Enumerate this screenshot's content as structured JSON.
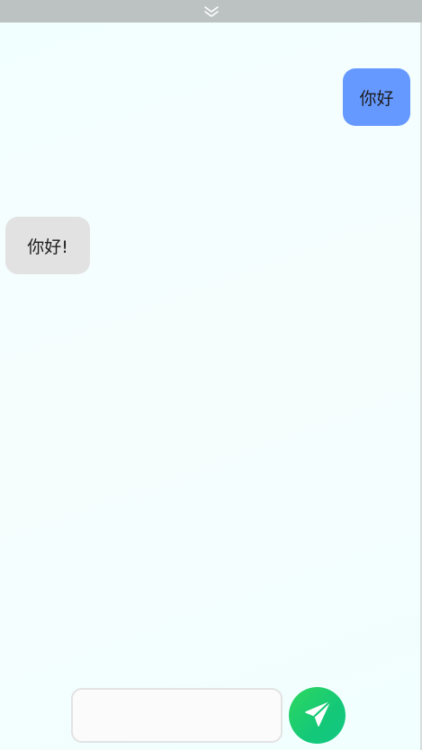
{
  "header": {
    "collapse_icon": "double-chevron-down-icon"
  },
  "messages": [
    {
      "role": "user",
      "text": "你好"
    },
    {
      "role": "assistant",
      "text": "你好!"
    }
  ],
  "composer": {
    "input_value": "",
    "placeholder": "",
    "send_icon": "paper-plane-icon"
  },
  "colors": {
    "user_bubble": "#6699ff",
    "assistant_bubble": "#e2e2e2",
    "send_button": "#1fd06a",
    "topbar": "#bcc2c2"
  }
}
